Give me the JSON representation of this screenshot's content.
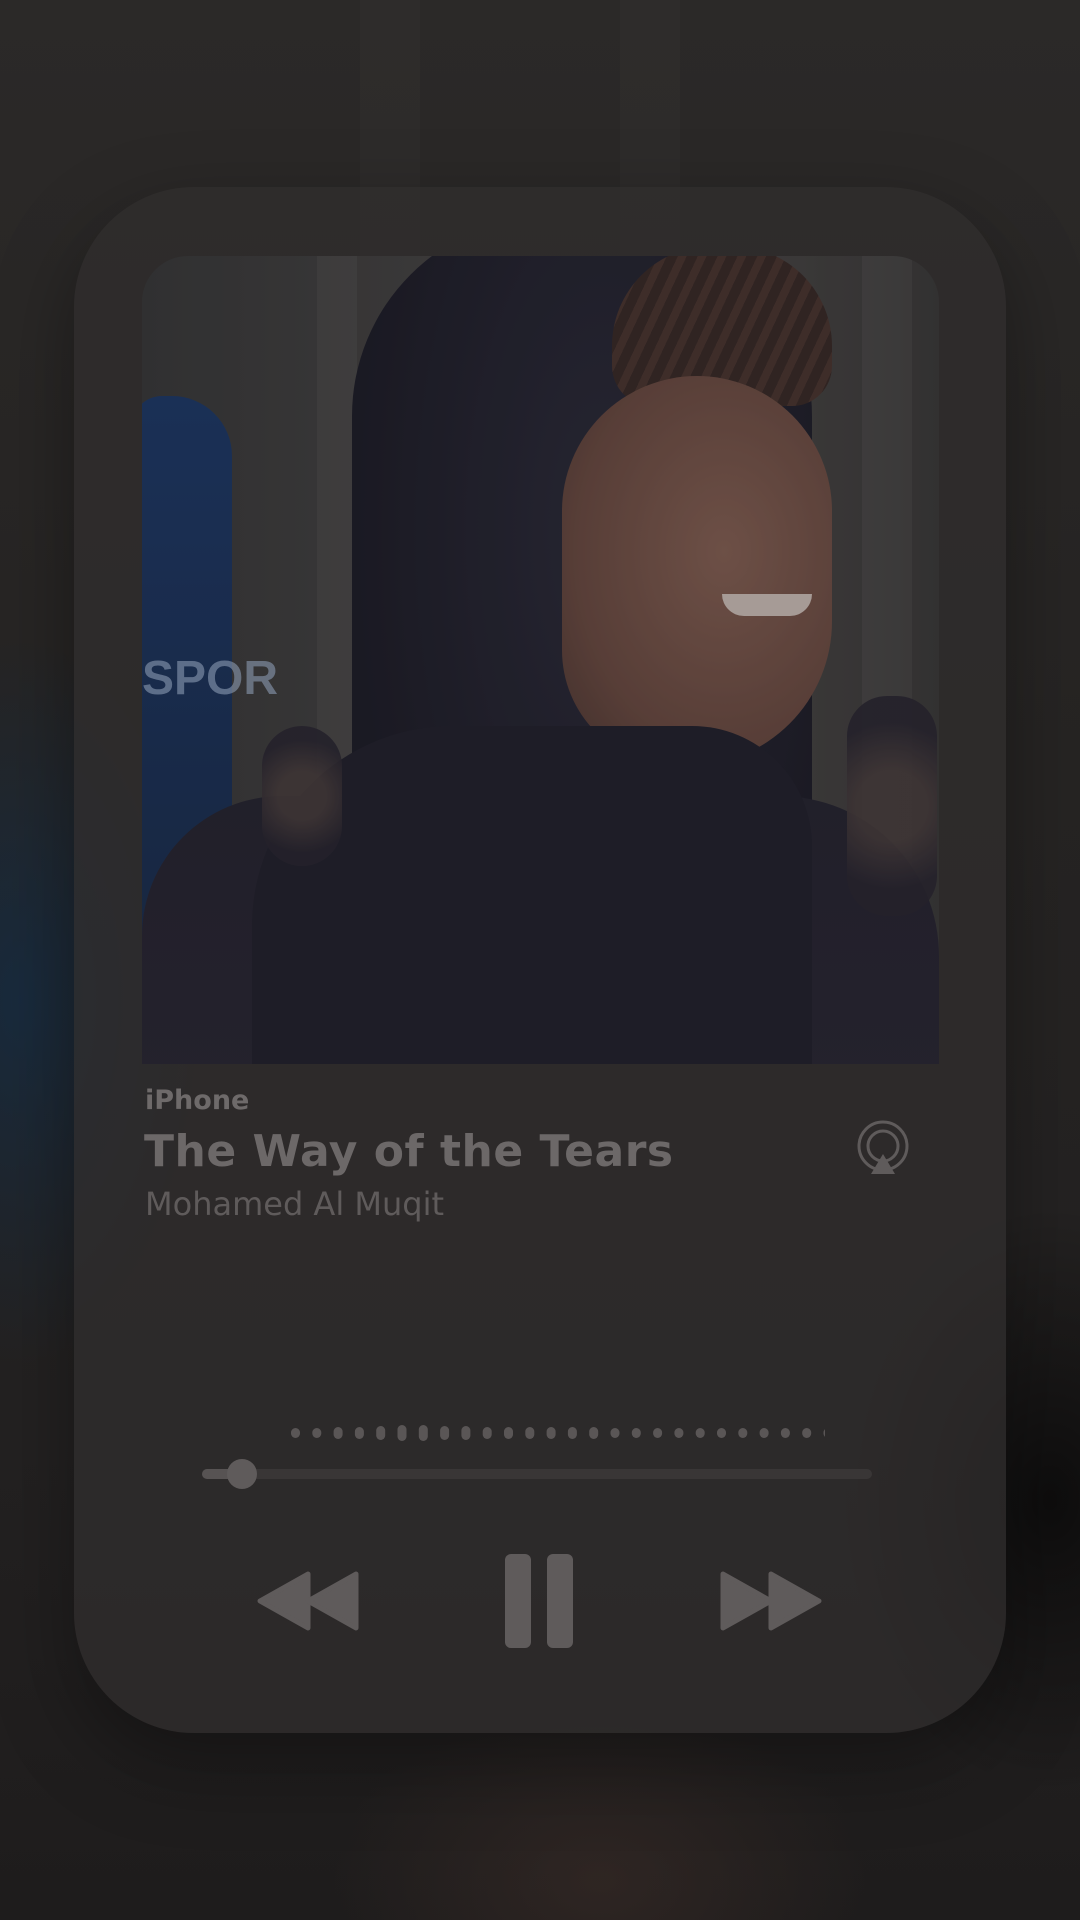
{
  "now_playing": {
    "device": "iPhone",
    "title": "The Way of the Tears",
    "artist": "Mohamed Al Muqit"
  },
  "artwork": {
    "visible_text": "SPOR",
    "description_icon": "album-artwork-image"
  },
  "controls": {
    "airplay_icon": "airplay-icon",
    "rewind_icon": "rewind-icon",
    "pause_icon": "pause-icon",
    "forward_icon": "fast-forward-icon"
  },
  "progress": {
    "fraction": 0.06
  },
  "colors": {
    "background": "#262424",
    "card": "#302e2e",
    "text_primary": "#6c6868",
    "text_secondary": "#5f5b5b",
    "control": "#5f5b5b"
  }
}
